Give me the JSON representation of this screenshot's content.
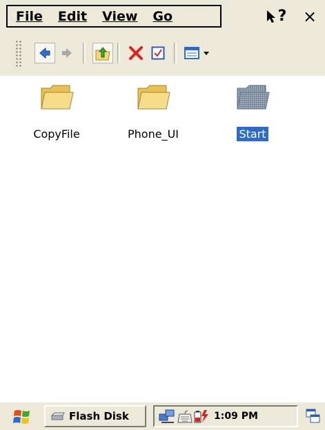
{
  "menu": {
    "items": [
      {
        "label": "File"
      },
      {
        "label": "Edit"
      },
      {
        "label": "View"
      },
      {
        "label": "Go"
      }
    ],
    "help_label": "?",
    "close_label": "×"
  },
  "toolbar": {
    "buttons": [
      "back-icon",
      "forward-icon",
      "up-folder-icon",
      "delete-icon",
      "properties-icon",
      "view-menu-icon"
    ]
  },
  "files": [
    {
      "name": "CopyFile",
      "selected": false
    },
    {
      "name": "Phone_UI",
      "selected": false
    },
    {
      "name": "Start",
      "selected": true
    }
  ],
  "taskbar": {
    "task_label": "Flash Disk",
    "clock": "1:09 PM"
  },
  "colors": {
    "chrome": "#ece9d8",
    "selection": "#316ac5",
    "folder": "#f6d776"
  }
}
